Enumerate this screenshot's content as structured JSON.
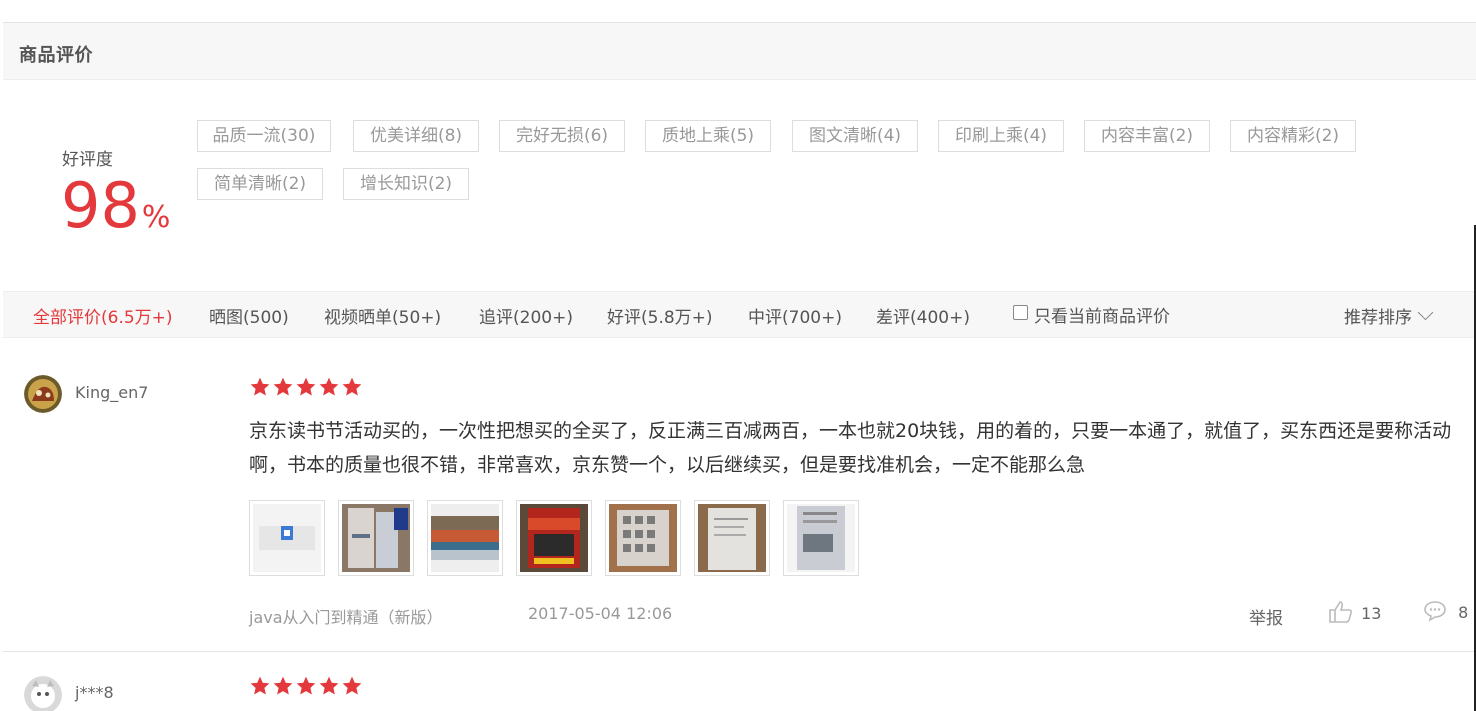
{
  "section": {
    "title": "商品评价"
  },
  "summary": {
    "label": "好评度",
    "value": "98",
    "unit": "%",
    "tags": [
      "品质一流(30)",
      "优美详细(8)",
      "完好无损(6)",
      "质地上乘(5)",
      "图文清晰(4)",
      "印刷上乘(4)",
      "内容丰富(2)",
      "内容精彩(2)",
      "简单清晰(2)",
      "增长知识(2)"
    ]
  },
  "filters": {
    "tabs": [
      "全部评价(6.5万+)",
      "晒图(500)",
      "视频晒单(50+)",
      "追评(200+)",
      "好评(5.8万+)",
      "中评(700+)",
      "差评(400+)"
    ],
    "active_index": 0,
    "only_current_label": "只看当前商品评价",
    "only_current_checked": false,
    "sort_label": "推荐排序"
  },
  "reviews": [
    {
      "user": "King_en7",
      "rating": 5,
      "text": "京东读书节活动买的，一次性把想买的全买了，反正满三百减两百，一本也就20块钱，用的着的，只要一本通了，就值了，买东西还是要称活动啊，书本的质量也很不错，非常喜欢，京东赞一个，以后继续买，但是要找准机会，一定不能那么急",
      "product": "java从入门到精通（新版）",
      "date": "2017-05-04 12:06",
      "report": "举报",
      "likes": "13",
      "replies": "8",
      "images": [
        "book-cover-photo",
        "stacked-books-photo",
        "shelf-photo",
        "java-book-photo",
        "dice-photo",
        "page-photo",
        "printed-page-photo"
      ]
    },
    {
      "user": "j***8",
      "rating": 5
    }
  ],
  "colors": {
    "accent": "#e4393c",
    "star": "#e4393c",
    "border": "#dddddd",
    "muted": "#999999"
  }
}
